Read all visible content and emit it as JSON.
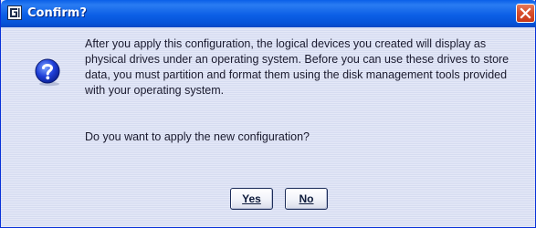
{
  "window": {
    "title": "Confirm?",
    "app_icon": "app-logo-icon",
    "close_icon": "close-icon"
  },
  "dialog": {
    "icon": "question-icon",
    "message_paragraph_1": "After you apply this configuration, the logical devices you created will display as physical drives under an operating system.  Before you can use these drives to store data, you must partition and format them using the disk management tools provided with your operating system.",
    "message_paragraph_2": "Do you want to apply the new configuration?"
  },
  "buttons": {
    "yes_label": "Yes",
    "no_label": "No"
  },
  "colors": {
    "titlebar": "#0a5fe8",
    "close_button": "#d9502d",
    "dialog_background": "#dfe3f4"
  }
}
